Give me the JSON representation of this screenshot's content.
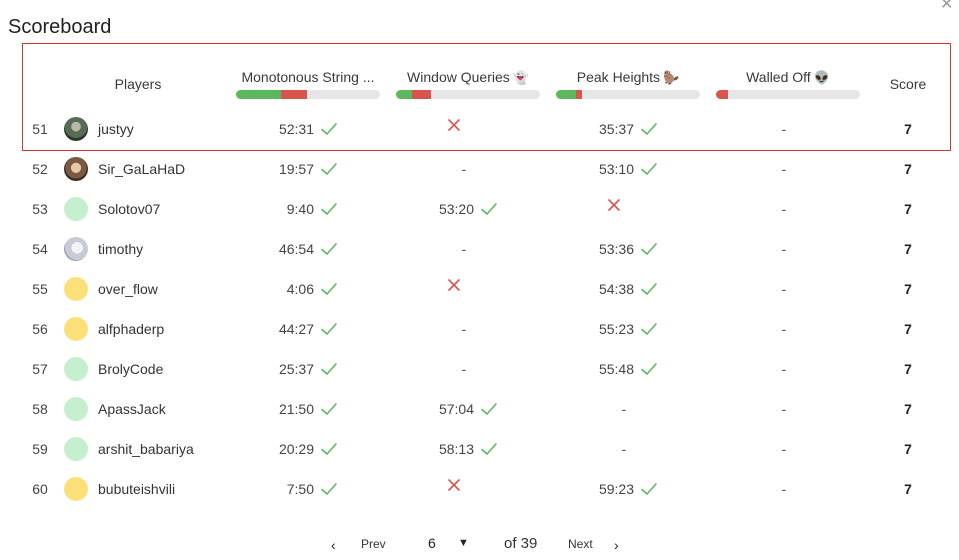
{
  "title": "Scoreboard",
  "close_icon": "close-icon",
  "header": {
    "players": "Players",
    "score": "Score",
    "problems": [
      {
        "name": "Monotonous String ...",
        "emoji": "",
        "solved_fraction": 0.31,
        "failed_fraction": 0.18
      },
      {
        "name": "Window Queries",
        "emoji": "👻",
        "solved_fraction": 0.11,
        "failed_fraction": 0.13
      },
      {
        "name": "Peak Heights",
        "emoji": "🦫",
        "solved_fraction": 0.14,
        "failed_fraction": 0.04
      },
      {
        "name": "Walled Off",
        "emoji": "👽",
        "solved_fraction": 0.0,
        "failed_fraction": 0.08
      }
    ]
  },
  "colors": {
    "solved": "#5cb85c",
    "failed": "#d9534f",
    "highlight": "#d9342b"
  },
  "rows": [
    {
      "rank": "51",
      "name": "justyy",
      "avatar": "photo1",
      "results": [
        {
          "t": "check",
          "time": "52:31"
        },
        {
          "t": "cross"
        },
        {
          "t": "check",
          "time": "35:37"
        },
        {
          "t": "dash",
          "text": "-"
        }
      ],
      "score": "7"
    },
    {
      "rank": "52",
      "name": "Sir_GaLaHaD",
      "avatar": "photo2",
      "results": [
        {
          "t": "check",
          "time": "19:57"
        },
        {
          "t": "dash",
          "text": "-"
        },
        {
          "t": "check",
          "time": "53:10"
        },
        {
          "t": "dash",
          "text": "-"
        }
      ],
      "score": "7"
    },
    {
      "rank": "53",
      "name": "Solotov07",
      "avatar": "green",
      "results": [
        {
          "t": "check",
          "time": "9:40"
        },
        {
          "t": "check",
          "time": "53:20"
        },
        {
          "t": "cross"
        },
        {
          "t": "dash",
          "text": "-"
        }
      ],
      "score": "7"
    },
    {
      "rank": "54",
      "name": "timothy",
      "avatar": "photo3",
      "results": [
        {
          "t": "check",
          "time": "46:54"
        },
        {
          "t": "dash",
          "text": "-"
        },
        {
          "t": "check",
          "time": "53:36"
        },
        {
          "t": "dash",
          "text": "-"
        }
      ],
      "score": "7"
    },
    {
      "rank": "55",
      "name": "over_flow",
      "avatar": "yellow",
      "results": [
        {
          "t": "check",
          "time": "4:06"
        },
        {
          "t": "cross"
        },
        {
          "t": "check",
          "time": "54:38"
        },
        {
          "t": "dash",
          "text": "-"
        }
      ],
      "score": "7"
    },
    {
      "rank": "56",
      "name": "alfphaderp",
      "avatar": "yellow",
      "results": [
        {
          "t": "check",
          "time": "44:27"
        },
        {
          "t": "dash",
          "text": "-"
        },
        {
          "t": "check",
          "time": "55:23"
        },
        {
          "t": "dash",
          "text": "-"
        }
      ],
      "score": "7"
    },
    {
      "rank": "57",
      "name": "BrolyCode",
      "avatar": "green",
      "results": [
        {
          "t": "check",
          "time": "25:37"
        },
        {
          "t": "dash",
          "text": "-"
        },
        {
          "t": "check",
          "time": "55:48"
        },
        {
          "t": "dash",
          "text": "-"
        }
      ],
      "score": "7"
    },
    {
      "rank": "58",
      "name": "ApassJack",
      "avatar": "green",
      "results": [
        {
          "t": "check",
          "time": "21:50"
        },
        {
          "t": "check",
          "time": "57:04"
        },
        {
          "t": "dash",
          "text": "-"
        },
        {
          "t": "dash",
          "text": "-"
        }
      ],
      "score": "7"
    },
    {
      "rank": "59",
      "name": "arshit_babariya",
      "avatar": "green",
      "results": [
        {
          "t": "check",
          "time": "20:29"
        },
        {
          "t": "check",
          "time": "58:13"
        },
        {
          "t": "dash",
          "text": "-"
        },
        {
          "t": "dash",
          "text": "-"
        }
      ],
      "score": "7"
    },
    {
      "rank": "60",
      "name": "bubuteishvili",
      "avatar": "yellow",
      "results": [
        {
          "t": "check",
          "time": "7:50"
        },
        {
          "t": "cross"
        },
        {
          "t": "check",
          "time": "59:23"
        },
        {
          "t": "dash",
          "text": "-"
        }
      ],
      "score": "7"
    }
  ],
  "pagination": {
    "prev_label": "Prev",
    "next_label": "Next",
    "current_page": "6",
    "of_label": "of 39",
    "prev_icon": "chevron-left-icon",
    "next_icon": "chevron-right-icon",
    "caret_icon": "caret-down-icon"
  }
}
